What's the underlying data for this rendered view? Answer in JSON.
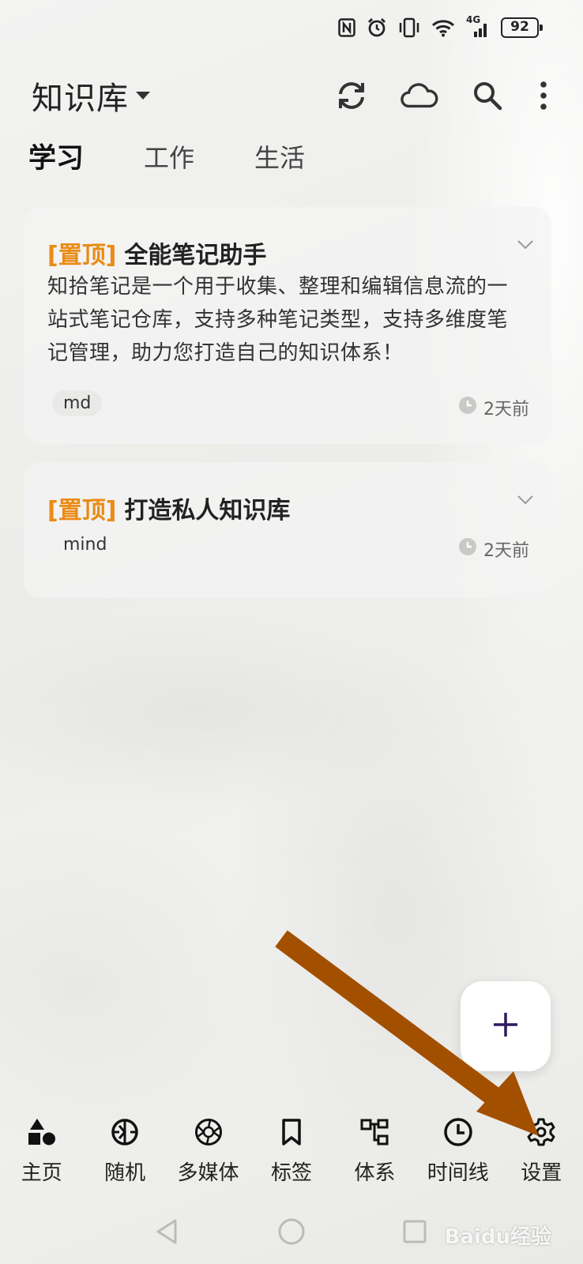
{
  "status_bar": {
    "battery": "92",
    "network": "4G",
    "icons": [
      "nfc-icon",
      "alarm-icon",
      "vibrate-icon",
      "wifi-icon",
      "signal-icon",
      "battery-icon"
    ]
  },
  "header": {
    "title": "知识库",
    "actions": [
      "sync-icon",
      "cloud-icon",
      "search-icon",
      "more-icon"
    ]
  },
  "tabs": [
    {
      "label": "学习",
      "active": true
    },
    {
      "label": "工作",
      "active": false
    },
    {
      "label": "生活",
      "active": false
    }
  ],
  "notes": [
    {
      "pin_label": "[置顶]",
      "title": "全能笔记助手",
      "body": "知拾笔记是一个用于收集、整理和编辑信息流的一站式笔记仓库，支持多种笔记类型，支持多维度笔记管理，助力您打造自己的知识体系！",
      "tag": "md",
      "time": "2天前"
    },
    {
      "pin_label": "[置顶]",
      "title": "打造私人知识库",
      "body": "",
      "tag": "mind",
      "time": "2天前"
    }
  ],
  "fab": {
    "icon": "plus-icon",
    "color": "#2e1a5e"
  },
  "bottom_nav": [
    {
      "label": "主页",
      "icon": "shapes-icon"
    },
    {
      "label": "随机",
      "icon": "random-icon"
    },
    {
      "label": "多媒体",
      "icon": "aperture-icon"
    },
    {
      "label": "标签",
      "icon": "bookmark-icon"
    },
    {
      "label": "体系",
      "icon": "hierarchy-icon"
    },
    {
      "label": "时间线",
      "icon": "clock-icon"
    },
    {
      "label": "设置",
      "icon": "gear-icon"
    }
  ],
  "annotation": {
    "type": "arrow",
    "color": "#a34f00",
    "points_to": "设置"
  },
  "watermark": "Baidu经验",
  "colors": {
    "pin": "#e98b16",
    "accent": "#2e1a5e",
    "arrow": "#a34f00"
  }
}
